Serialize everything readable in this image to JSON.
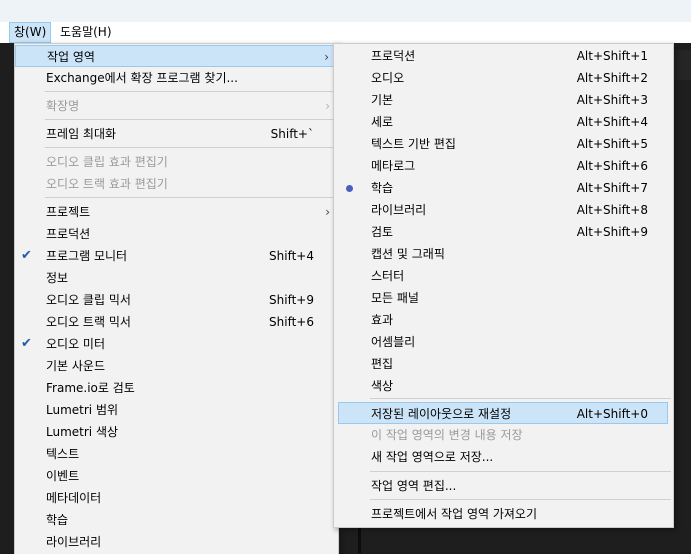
{
  "menubar": {
    "window": "창(W)",
    "help": "도움말(H)"
  },
  "main_menu": {
    "workspace": "작업 영역",
    "exchange": "Exchange에서 확장 프로그램 찾기...",
    "extensions": "확장명",
    "maximize": {
      "label": "프레임 최대화",
      "shortcut": "Shift+`"
    },
    "audio_clip_effect": "오디오 클립 효과 편집기",
    "audio_track_effect": "오디오 트랙 효과 편집기",
    "projects": "프로젝트",
    "production": "프로덕션",
    "program_monitor": {
      "label": "프로그램 모니터",
      "shortcut": "Shift+4"
    },
    "info": "정보",
    "audio_clip_mixer": {
      "label": "오디오 클립 믹서",
      "shortcut": "Shift+9"
    },
    "audio_track_mixer": {
      "label": "오디오 트랙 믹서",
      "shortcut": "Shift+6"
    },
    "audio_meter": "오디오 미터",
    "essential_sound": "기본 사운드",
    "frameio": "Frame.io로 검토",
    "lumetri_scopes": "Lumetri 범위",
    "lumetri_color": "Lumetri 색상",
    "text": "텍스트",
    "events": "이벤트",
    "metadata": "메타데이터",
    "learn": "학습",
    "libraries": "라이브러리"
  },
  "sub_menu": {
    "items": [
      {
        "label": "프로덕션",
        "shortcut": "Alt+Shift+1"
      },
      {
        "label": "오디오",
        "shortcut": "Alt+Shift+2"
      },
      {
        "label": "기본",
        "shortcut": "Alt+Shift+3"
      },
      {
        "label": "세로",
        "shortcut": "Alt+Shift+4"
      },
      {
        "label": "텍스트 기반 편집",
        "shortcut": "Alt+Shift+5"
      },
      {
        "label": "메타로그",
        "shortcut": "Alt+Shift+6"
      },
      {
        "label": "학습",
        "shortcut": "Alt+Shift+7"
      },
      {
        "label": "라이브러리",
        "shortcut": "Alt+Shift+8"
      },
      {
        "label": "검토",
        "shortcut": "Alt+Shift+9"
      },
      {
        "label": "캡션 및 그래픽",
        "shortcut": ""
      },
      {
        "label": "스터터",
        "shortcut": ""
      },
      {
        "label": "모든 패널",
        "shortcut": ""
      },
      {
        "label": "효과",
        "shortcut": ""
      },
      {
        "label": "어셈블리",
        "shortcut": ""
      },
      {
        "label": "편집",
        "shortcut": ""
      },
      {
        "label": "색상",
        "shortcut": ""
      }
    ],
    "reset": {
      "label": "저장된 레이아웃으로 재설정",
      "shortcut": "Alt+Shift+0"
    },
    "save_changes": "이 작업 영역의 변경 내용 저장",
    "save_new": "새 작업 영역으로 저장...",
    "edit_workspaces": "작업 영역 편집...",
    "import_from_projects": "프로젝트에서 작업 영역 가져오기"
  }
}
